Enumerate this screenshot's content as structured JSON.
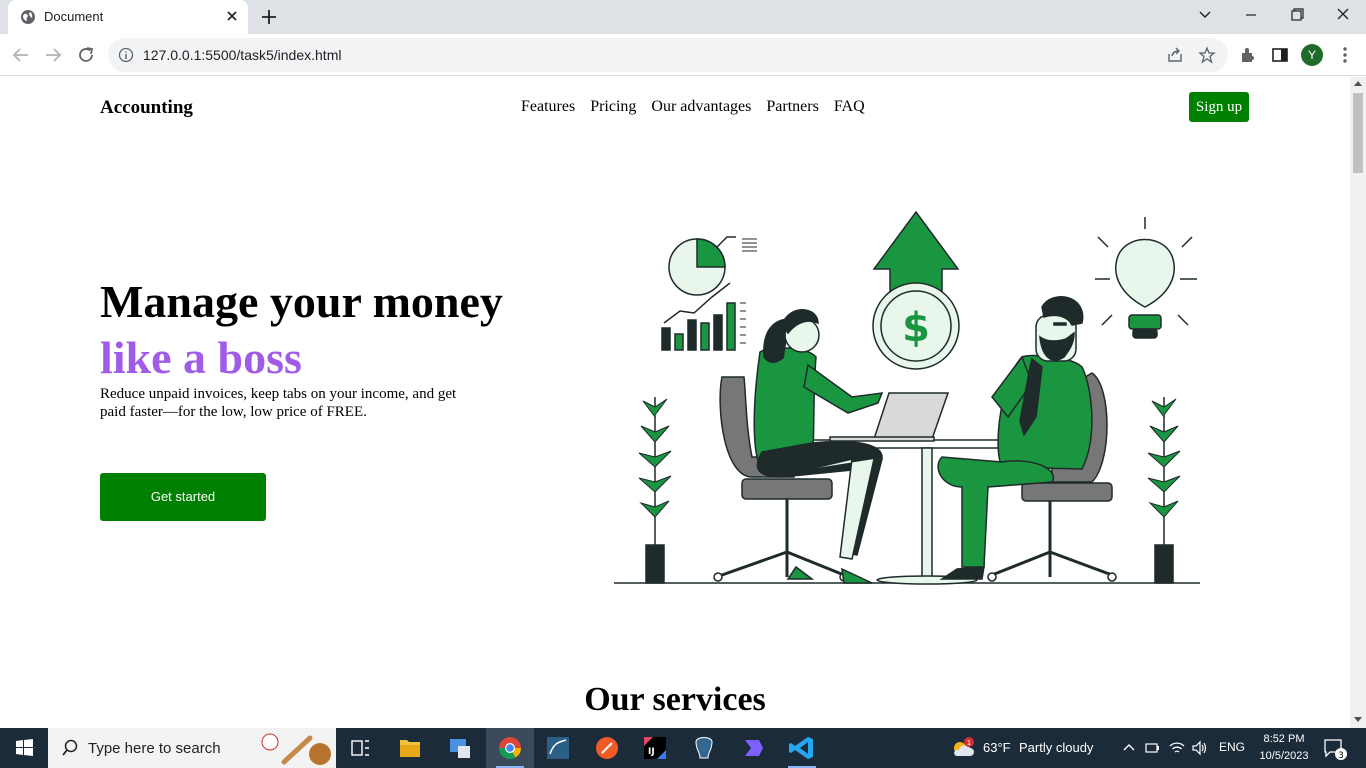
{
  "browser": {
    "tab_title": "Document",
    "url": "127.0.0.1:5500/task5/index.html",
    "profile_initial": "Y"
  },
  "page": {
    "logo": "Accounting",
    "nav": [
      "Features",
      "Pricing",
      "Our advantages",
      "Partners",
      "FAQ"
    ],
    "signup": "Sign up",
    "hero": {
      "title_line1": "Manage your money",
      "title_line2": "like a boss",
      "description": "Reduce unpaid invoices, keep tabs on your income, and get paid faster—for the low, low price of FREE.",
      "cta": "Get started"
    },
    "services_heading": "Our services",
    "colors": {
      "accent": "#008000",
      "highlight": "#a05ce6",
      "illustration_green": "#1a9641"
    }
  },
  "taskbar": {
    "search_placeholder": "Type here to search",
    "weather_temp": "63°F",
    "weather_desc": "Partly cloudy",
    "weather_badge": "1",
    "language": "ENG",
    "time": "8:52 PM",
    "date": "10/5/2023",
    "notification_count": "3"
  }
}
